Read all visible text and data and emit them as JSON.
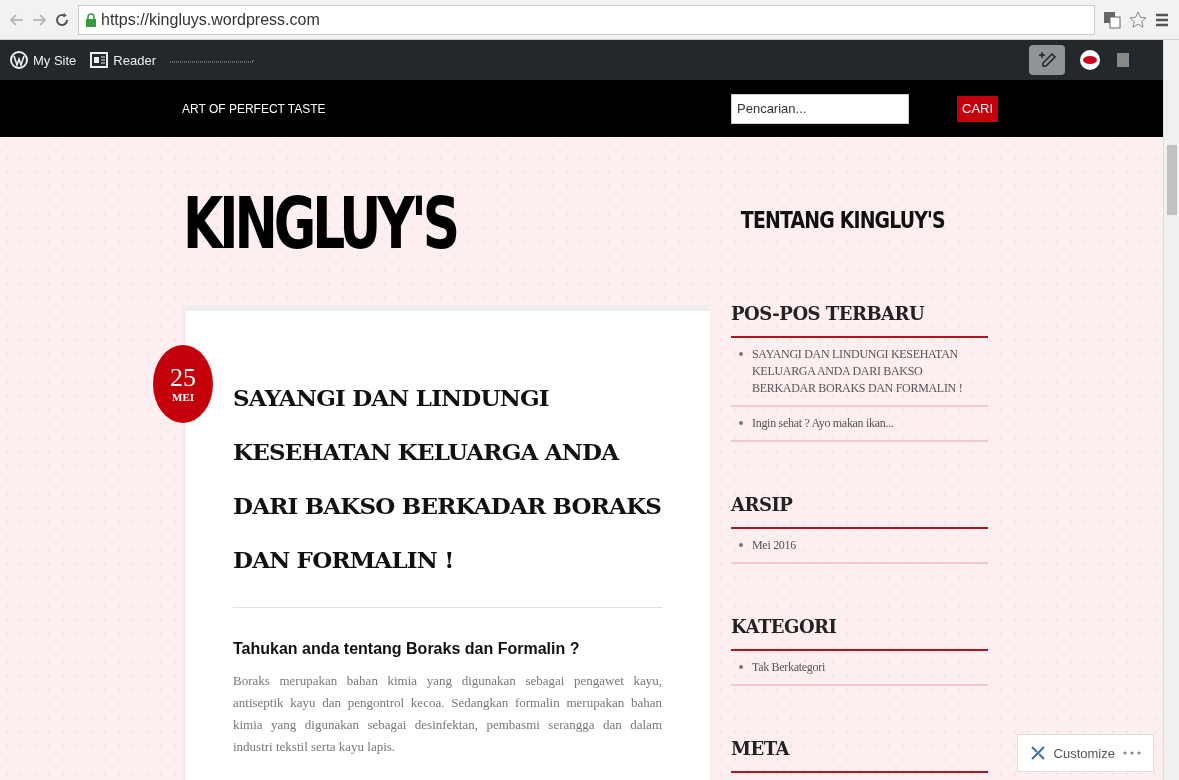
{
  "browser": {
    "url": "https://kingluys.wordpress.com"
  },
  "admin_bar": {
    "items": [
      {
        "label": "My Site",
        "kind": "wp"
      },
      {
        "label": "Reader",
        "kind": "reader"
      }
    ]
  },
  "header": {
    "tagline": "ART OF PERFECT TASTE",
    "search": {
      "placeholder": "Pencarian..."
    },
    "search_button": "CARI"
  },
  "site_title": "KINGLUY'S",
  "post": {
    "day": "25",
    "month": "MEI",
    "title": "SAYANGI DAN LINDUNGI KESEHATAN KELUARGA ANDA DARI BAKSO BERKADAR BORAKS DAN FORMALIN !",
    "subheading": "Tahukan anda tentang Boraks dan Formalin ?",
    "paragraph": "Boraks merupakan bahan kimia yang digunakan sebagai pengawet kayu, antiseptik kayu dan pengontrol kecoa. Sedangkan formalin merupakan bahan kimia yang digunakan sebagai desinfektan, pembasmi serangga dan dalam industri tekstil serta kayu lapis."
  },
  "sidebar": {
    "about_title": "TENTANG KINGLUY'S",
    "widgets": [
      {
        "title": "POS-POS TERBARU",
        "items": [
          "SAYANGI DAN LINDUNGI KESEHATAN KELUARGA ANDA DARI BAKSO BERKADAR BORAKS DAN FORMALIN !",
          "Ingin sehat ? Ayo makan ikan..."
        ]
      },
      {
        "title": "ARSIP",
        "items": [
          "Mei 2016"
        ]
      },
      {
        "title": "KATEGORI",
        "items": [
          "Tak Berkategori"
        ]
      },
      {
        "title": "META"
      }
    ]
  },
  "customize": {
    "label": "Customize"
  }
}
